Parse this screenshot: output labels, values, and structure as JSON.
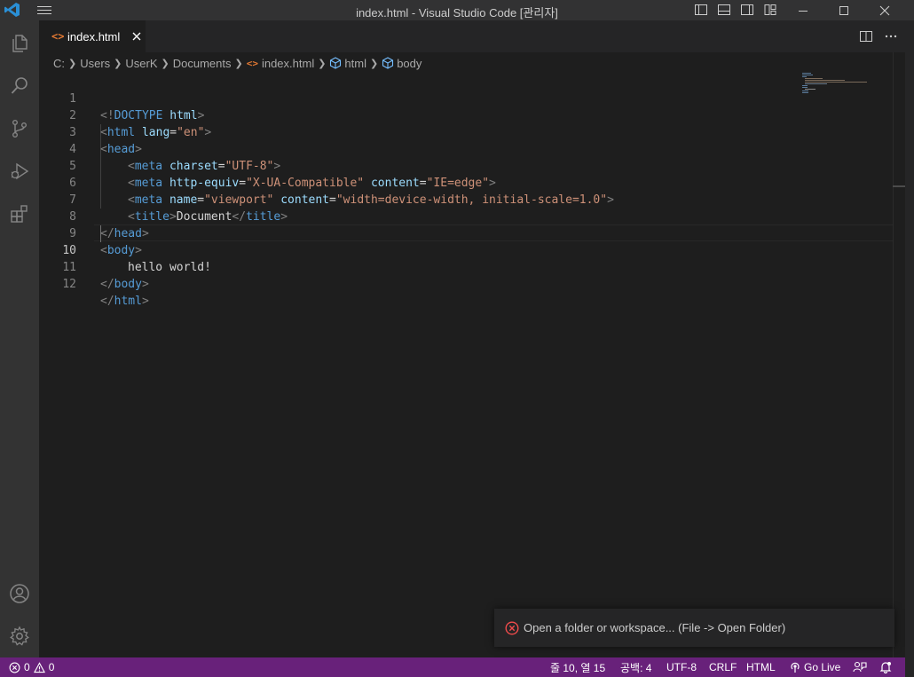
{
  "window": {
    "title": "index.html - Visual Studio Code [관리자]"
  },
  "tab": {
    "label": "index.html",
    "file_icon": "<>"
  },
  "breadcrumb": {
    "items": [
      "C:",
      "Users",
      "UserK",
      "Documents",
      "index.html",
      "html",
      "body"
    ]
  },
  "editor": {
    "current_line": 10,
    "lines": [
      {
        "n": "1"
      },
      {
        "n": "2"
      },
      {
        "n": "3"
      },
      {
        "n": "4"
      },
      {
        "n": "5"
      },
      {
        "n": "6"
      },
      {
        "n": "7"
      },
      {
        "n": "8"
      },
      {
        "n": "9"
      },
      {
        "n": "10"
      },
      {
        "n": "11"
      },
      {
        "n": "12"
      }
    ],
    "tokens": {
      "l1": [
        "<!",
        "DOCTYPE",
        " ",
        "html",
        ">"
      ],
      "l2": [
        "<",
        "html",
        " ",
        "lang",
        "=",
        "\"en\"",
        ">"
      ],
      "l3": [
        "<",
        "head",
        ">"
      ],
      "l4": [
        "<",
        "meta",
        " ",
        "charset",
        "=",
        "\"UTF-8\"",
        ">"
      ],
      "l5": [
        "<",
        "meta",
        " ",
        "http-equiv",
        "=",
        "\"X-UA-Compatible\"",
        " ",
        "content",
        "=",
        "\"IE=edge\"",
        ">"
      ],
      "l6": [
        "<",
        "meta",
        " ",
        "name",
        "=",
        "\"viewport\"",
        " ",
        "content",
        "=",
        "\"width=device-width, initial-scale=1.0\"",
        ">"
      ],
      "l7": [
        "<",
        "title",
        ">",
        "Document",
        "</",
        "title",
        ">"
      ],
      "l8": [
        "</",
        "head",
        ">"
      ],
      "l9": [
        "<",
        "body",
        ">"
      ],
      "l10": [
        "hello world!"
      ],
      "l11": [
        "</",
        "body",
        ">"
      ],
      "l12": [
        "</",
        "html",
        ">"
      ]
    }
  },
  "notification": {
    "message": "Open a folder or workspace... (File -> Open Folder)"
  },
  "statusbar": {
    "errors": "0",
    "warnings": "0",
    "cursor": "줄 10, 열 15",
    "spaces": "공백: 4",
    "encoding": "UTF-8",
    "eol": "CRLF",
    "language": "HTML",
    "golive": "Go Live"
  },
  "colors": {
    "statusbar_bg": "#68217a",
    "editor_bg": "#1e1e1e",
    "accent_blue": "#007acc"
  }
}
